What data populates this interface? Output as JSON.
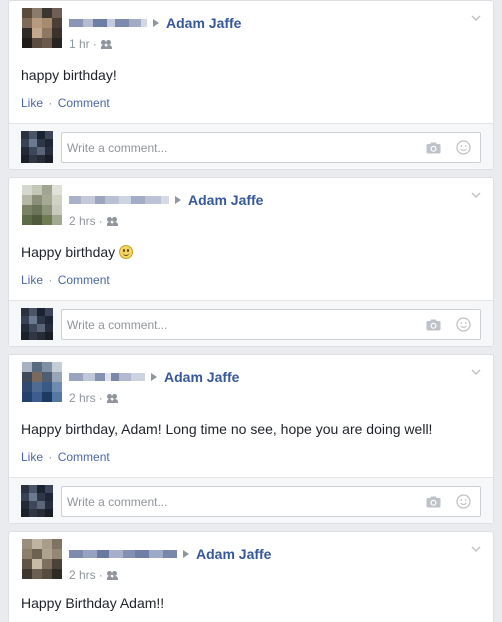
{
  "placeholder": "Write a comment...",
  "actions": {
    "like": "Like",
    "separator": " · ",
    "comment": "Comment"
  },
  "posts": [
    {
      "target": "Adam Jaffe",
      "time": "1 hr",
      "dot": "·",
      "text": "happy birthday!"
    },
    {
      "target": "Adam Jaffe",
      "time": "2 hrs",
      "dot": "·",
      "text": "Happy birthday"
    },
    {
      "target": "Adam Jaffe",
      "time": "2 hrs",
      "dot": "·",
      "text": "Happy birthday, Adam! Long time no see, hope you are doing well!"
    },
    {
      "target": "Adam Jaffe",
      "time": "2 hrs",
      "dot": "·",
      "text": "Happy Birthday Adam!!"
    }
  ],
  "colors": {
    "link": "#365899",
    "meta": "#90949c",
    "background": "#e9ebee"
  }
}
